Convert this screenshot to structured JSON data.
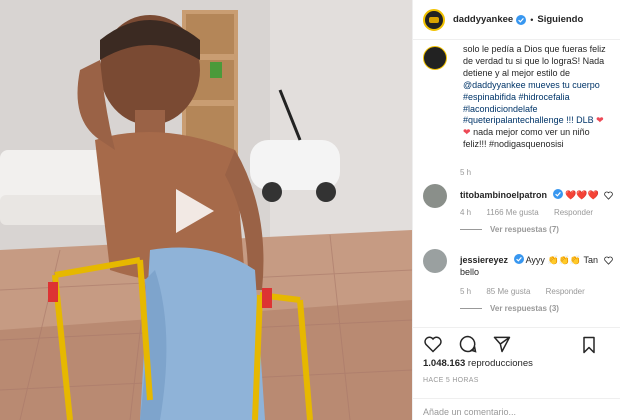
{
  "post": {
    "username": "daddyyankee",
    "separator": "•",
    "follow_status": "Siguiendo",
    "caption_lines": [
      "solo le pedía a Dios que fueras feliz",
      "de verdad tu si que lo lograS! Nada",
      "detiene y al mejor estilo de",
      "@daddyyankee mueves tu cuerpo",
      "#espinabifida #hidrocefalia",
      "#lacondiciondelafe",
      "#queteripalantechallenge !!! DLB",
      "nada mejor como ver un niño",
      "feliz!!! #nodigasquenosisi"
    ],
    "caption_time": "5 h"
  },
  "comments": [
    {
      "username": "titobambinoelpatron",
      "text": "❤️❤️❤️",
      "time": "4 h",
      "likes": "1166 Me gusta",
      "reply": "Responder",
      "replies": "Ver respuestas (7)"
    },
    {
      "username": "jessiereyez",
      "text": "Ayyy 👏🏽👏🏽👏🏽 Tan bello",
      "text_line1": "Ayyy",
      "text_line2": "bello",
      "clap_glyph": "👏",
      "tan": "Tan",
      "time": "5 h",
      "likes": "85 Me gusta",
      "reply": "Responder",
      "replies": "Ver respuestas (3)"
    }
  ],
  "stats": {
    "views_number": "1.048.163",
    "views_label": "reproducciones",
    "ago": "HACE 5 HORAS"
  },
  "input": {
    "placeholder": "Añade un comentario..."
  },
  "colors": {
    "link": "#003569",
    "muted": "#999999",
    "verified_blue": "#3897f0",
    "heart_red": "#ed4956",
    "walker_yellow": "#e6b800"
  },
  "icons": {
    "play": "play-icon",
    "like": "heart-icon",
    "comment": "comment-icon",
    "share": "share-icon",
    "save": "bookmark-icon"
  }
}
